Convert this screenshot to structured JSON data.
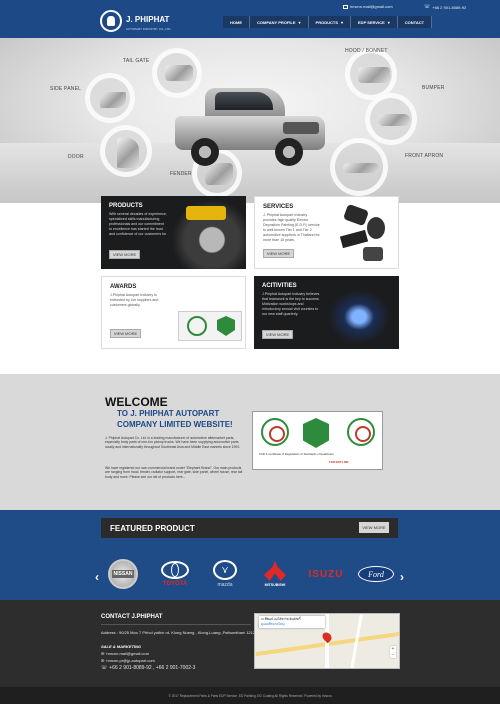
{
  "header": {
    "brand": "J. PHIPHAT",
    "tagline": "AUTOPART INDUSTRY CO.,LTD.",
    "email": "hmcnn.mail@gmail.com",
    "phone": "+66 2 901-8089-92",
    "nav": [
      {
        "label": "HOME",
        "caret": false
      },
      {
        "label": "COMPANY PROFILE",
        "caret": true
      },
      {
        "label": "PRODUCTS",
        "caret": true
      },
      {
        "label": "EDP SERVICE",
        "caret": true
      },
      {
        "label": "CONTACT",
        "caret": false
      }
    ]
  },
  "hero": {
    "labels": {
      "tail_gate": "TAIL GATE",
      "hood": "HOOD / BONNET",
      "side_panel": "SIDE PANEL",
      "bumper": "BUMPER",
      "door": "DOOR",
      "front_apron": "FRONT APRON",
      "fender": "FENDER"
    }
  },
  "cards": {
    "products": {
      "title": "PRODUCTS",
      "text": "With several decades of experience, specialized skills manufacturing professionals and our commitment to excellence has started the trust and confidence of our customers for",
      "button": "VIEW MORE"
    },
    "services": {
      "title": "SERVICES",
      "text": "J. Phiphat Autopart Industry provides high quality Electro Deposition Painting (E.D.P.) service to well-known Tier 1 and Tier 2 automotive suppliers in Thailand for more than 15 years.",
      "button": "VIEW MORE"
    },
    "awards": {
      "title": "AWARDS",
      "text": "J.Phiphat Autopart Industry is entrusted by our suppliers and customers globally.",
      "button": "VIEW MORE"
    },
    "activities": {
      "title": "ACITIVITIES",
      "text": "J.Phiphat Autopart Industry believes that teamwork is the key to success. Motivation workshops and introductory annual visit counties to our new staff quarterly.",
      "button": "VIEW MORE"
    }
  },
  "welcome": {
    "title": "WELCOME",
    "subtitle": "TO J. PHIPHAT AUTOPART COMPANY LIMITED WEBSITE!",
    "para1": "J. Phiphat Autopart Co. Ltd. is a leading manufacturer of automotive aftermarket parts, especially body parts of one-ton pickup trucks. We have been supplying automotive parts locally and internationally throughout Southeast Asia and Middle East markets since 1992.",
    "para2": "We have registered our own commercial brand under \"Elephant Brand\". Our main products are ranging from hood, fender, radiator support, rear gate, side panel, wheel house, rear tail body and more. Please see our list of products here...",
    "cert_caption": "CSR & Certificate of Registration of Standards of Healthcare",
    "cert_caption2": "FOR EDP LINE"
  },
  "featured": {
    "title": "FEATURED PRODUCT",
    "button": "VIEW MORE",
    "prev": "‹",
    "next": "›",
    "brands": [
      "NISSAN",
      "TOYOTA",
      "mazda",
      "MITSUBISHI",
      "ISUZU",
      "Ford"
    ]
  },
  "footer": {
    "title": "CONTACT J.PHIPHAT",
    "address": "Address : 90/25 Moo 7 Phhol yothin rd. Klong Nueng , Klong-Luang ,Pathumthani 12120",
    "sales_heading": "SALE & MARKETING",
    "email1": "hmcnn.mail@gmail.com",
    "email2": "hmcnn.pr@jp-autopart.com",
    "phone": "+66 2 901-8089-92 , +66 2 901-7002-3",
    "map_title": "เจ.พีพัฒน์ ออโต้พาร์ท อินดัสตรี้",
    "map_link": "ดูแผนที่ขนาดใหญ่",
    "copyright": "© 2017 Replacement Parts & Parts EDP Service, ED Painting, ED Coating All Rights Reserved. Powered by Innova"
  },
  "colors": {
    "brand_blue": "#1d4a86",
    "dark_bar": "#2b2b2b",
    "welcome_bg": "#d9d9d9",
    "subtitle_blue": "#1d4a86"
  }
}
